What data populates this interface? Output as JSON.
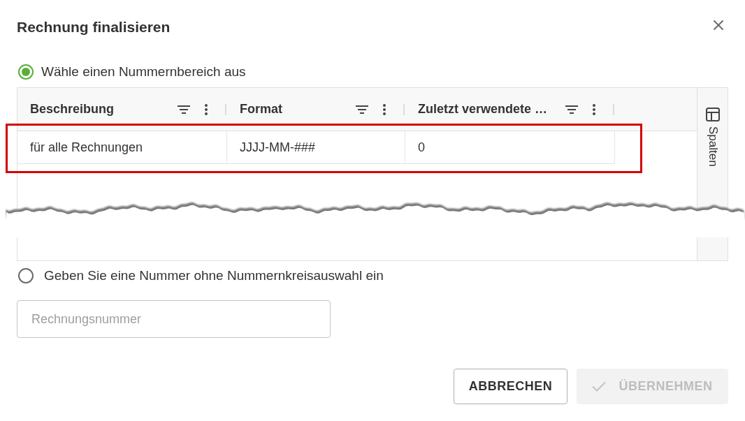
{
  "dialog": {
    "title": "Rechnung finalisieren"
  },
  "number_choice": [
    {
      "kind": "table",
      "label": "Wähle einen Nummernbereich aus",
      "selected": true,
      "table": {
        "columns": [
          {
            "label": "Beschreibung"
          },
          {
            "label": "Format"
          },
          {
            "label": "Zuletzt verwendete …"
          }
        ],
        "rows": [
          {
            "cells": [
              "für alle Rechnungen",
              "JJJJ-MM-###",
              "0"
            ],
            "highlighted": true
          }
        ],
        "side_panel": {
          "label": "Spalten"
        }
      }
    },
    {
      "kind": "field",
      "label": "Geben Sie eine Nummer ohne Nummernkreisauswahl ein",
      "selected": false,
      "field": {
        "placeholder": "Rechnungsnummer"
      }
    }
  ],
  "buttons": [
    {
      "kind": "cancel",
      "label": "ABBRECHEN",
      "disabled": false
    },
    {
      "kind": "confirm",
      "label": "ÜBERNEHMEN",
      "disabled": true
    }
  ]
}
